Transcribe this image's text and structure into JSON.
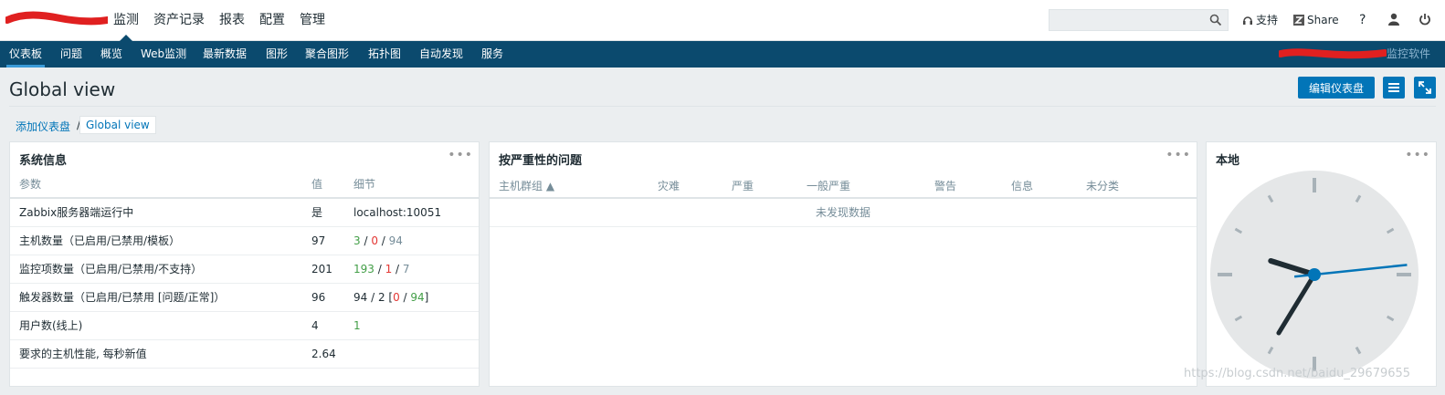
{
  "top_menu": [
    "监测",
    "资产记录",
    "报表",
    "配置",
    "管理"
  ],
  "top_right": {
    "support": "支持",
    "share": "Share",
    "help": "?"
  },
  "search": {
    "placeholder": ""
  },
  "sub_menu": [
    "仪表板",
    "问题",
    "概览",
    "Web监测",
    "最新数据",
    "图形",
    "聚合图形",
    "拓扑图",
    "自动发现",
    "服务"
  ],
  "monitor_link": "监控软件",
  "page": {
    "title": "Global view",
    "edit_button": "编辑仪表盘"
  },
  "breadcrumb": {
    "parent": "添加仪表盘",
    "separator": "/",
    "current": "Global view"
  },
  "system_info": {
    "title": "系统信息",
    "headers": [
      "参数",
      "值",
      "细节"
    ],
    "rows": [
      {
        "param": "Zabbix服务器端运行中",
        "value": "是",
        "d1": "localhost:10051",
        "d2": "",
        "d3": "",
        "d4": "",
        "d5": "",
        "d6": "",
        "d7": ""
      },
      {
        "param": "主机数量（已启用/已禁用/模板）",
        "value": "97",
        "d1": "3",
        "d2": " / ",
        "d3": "0",
        "d4": " / ",
        "d5": "94",
        "d6": "",
        "d7": ""
      },
      {
        "param": "监控项数量（已启用/已禁用/不支持）",
        "value": "201",
        "d1": "193",
        "d2": " / ",
        "d3": "1",
        "d4": " / ",
        "d5": "7",
        "d6": "",
        "d7": ""
      },
      {
        "param": "触发器数量（已启用/已禁用 [问题/正常]）",
        "value": "96",
        "d1": "94 / 2 [",
        "d2": "0",
        "d3": " / ",
        "d4": "94",
        "d5": "]",
        "d6": "",
        "d7": ""
      },
      {
        "param": "用户数(线上)",
        "value": "4",
        "d1": "1",
        "d2": "",
        "d3": "",
        "d4": "",
        "d5": "",
        "d6": "",
        "d7": ""
      },
      {
        "param": "要求的主机性能, 每秒新值",
        "value": "2.64",
        "d1": "",
        "d2": "",
        "d3": "",
        "d4": "",
        "d5": "",
        "d6": "",
        "d7": ""
      }
    ]
  },
  "problems": {
    "title": "按严重性的问题",
    "headers": [
      "主机群组 ▲",
      "灾难",
      "严重",
      "一般严重",
      "警告",
      "信息",
      "未分类"
    ],
    "empty_text": "未发现数据"
  },
  "clock": {
    "title": "本地",
    "hour": 9,
    "minute": 35,
    "second": 14
  },
  "watermark": "https://blog.csdn.net/baidu_29679655",
  "colors": {
    "brand": "#0b4a6e",
    "accent": "#0275b8",
    "ok": "#429e47",
    "problem": "#e33734"
  }
}
